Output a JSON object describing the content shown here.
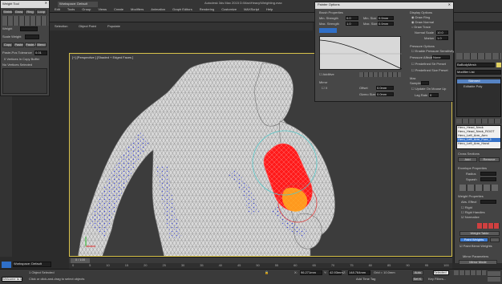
{
  "app": {
    "title": "Autodesk 3ds Max 2015   D:\\Max\\Heavy\\Weighting.max",
    "workspace": "Workspace: Default",
    "menu": [
      "Edit",
      "Tools",
      "Group",
      "Views",
      "Create",
      "Modifiers",
      "Animation",
      "Graph Editors",
      "Rendering",
      "Customize",
      "MAXScript",
      "Help"
    ],
    "ribbon_tabs": [
      "Selection",
      "Object Paint",
      "Populate"
    ]
  },
  "weight_tool": {
    "title": "Weight Tool",
    "buttons_row1": [
      "Shrink",
      "Grow",
      "Ring",
      "Loop"
    ],
    "weight_label": "Weight",
    "scale_label": "Scale Weight",
    "copy_buttons": [
      "Copy",
      "Paste",
      "Paste-Pos",
      "Paste-Pos"
    ],
    "blend_label": "Blend",
    "paste_tolerance": "Paste-Pos Tolerance",
    "tolerance_value": "0.01",
    "vertices_label": "0 Vertices In Copy Buffer",
    "selected_label": "No Vertices Selected"
  },
  "viewport": {
    "label": "[+] [Perspective ] [Shaded + Edged Faces ]",
    "axis_y": "y",
    "axis_x": "x"
  },
  "painter_options": {
    "title": "Painter Options",
    "brush_properties": "Brush Properties",
    "min_strength": "Min. Strength",
    "min_strength_val": "0.0",
    "max_strength": "Max. Strength",
    "max_strength_val": "1.0",
    "min_size": "Min. Size",
    "min_size_val": "0.0mm",
    "max_size": "Max. Size",
    "max_size_val": "0.0mm",
    "display_options": "Display Options",
    "draw_ring": "Draw Ring",
    "draw_normal": "Draw Normal",
    "draw_trace": "Draw Trace",
    "normal_scale": "Normal Scale",
    "normal_scale_val": "10.0",
    "marker": "Marker",
    "marker_val": "1.0",
    "pressure_options": "Pressure Options",
    "enable_pressure": "Enable Pressure Sensitivity",
    "pressure_affects": "Pressure Affects:",
    "pressure_val": "None",
    "additive": "Additive",
    "mirror": "Mirror",
    "mirror_axis": "X",
    "offset": "Offset",
    "offset_val": "0.0mm",
    "gizmo_size": "Gizmo Size",
    "gizmo_val": "0.0mm",
    "predefined_strength": "Predefined Str Preset",
    "predefined_size": "Predefined Size Preset",
    "max_samples_label": "Max",
    "samples": "Samples",
    "update_on_mouse_up": "Update On Mouse Up",
    "lag_rate": "Lag Rate",
    "lag_rate_val": "0"
  },
  "command_panel": {
    "object_name": "BaBodyMesh",
    "modifier_list": "Modifier List",
    "modifiers": [
      "Skinned",
      "Editable Poly"
    ],
    "bones": [
      "Hero_Head_Neck",
      "Hero_Head_Neck_ROOT",
      "Hero_Left_Arm_Arm",
      "Hero_Left_Arm_Fore_1",
      "Hero_Left_Arm_Hand"
    ],
    "cross_sections": "Cross Sections",
    "add": "Add",
    "remove": "Remove",
    "envelope_properties": "Envelope Properties",
    "radius": "Radius",
    "squash": "Squash",
    "weight_properties": "Weight Properties",
    "abs_effect": "Abs. Effect",
    "rigid": "Rigid",
    "rigid_handles": "Rigid Handles",
    "normalize": "Normalize",
    "paint_weights": "Paint Weights",
    "weight_table": "Weight Table",
    "paint_blend": "Paint Blend Weights",
    "mirror_parameters": "Mirror Parameters",
    "mirror_mode": "Mirror Mode"
  },
  "timeline": {
    "frame": "0 / 100",
    "ticks": [
      "0",
      "5",
      "10",
      "15",
      "20",
      "25",
      "30",
      "35",
      "40",
      "45",
      "50",
      "55",
      "60",
      "65",
      "70",
      "75",
      "80",
      "85",
      "90",
      "95",
      "100"
    ]
  },
  "status": {
    "workspace": "Workspace: Default",
    "objects_selected": "1 Object Selected",
    "prompt": "Click or click-and-drag to select objects",
    "x_label": "X:",
    "x_val": "96.271mm",
    "y_label": "Y:",
    "y_val": "42.93mm",
    "z_label": "Z:",
    "z_val": "148.764mm",
    "grid": "Grid = 10.0mm",
    "auto": "Auto",
    "selected": "Selected",
    "set_key": "Set K.",
    "key_filters": "Key Filters...",
    "add_time_tag": "Add Time Tag",
    "welcome": "Welcome to M"
  }
}
